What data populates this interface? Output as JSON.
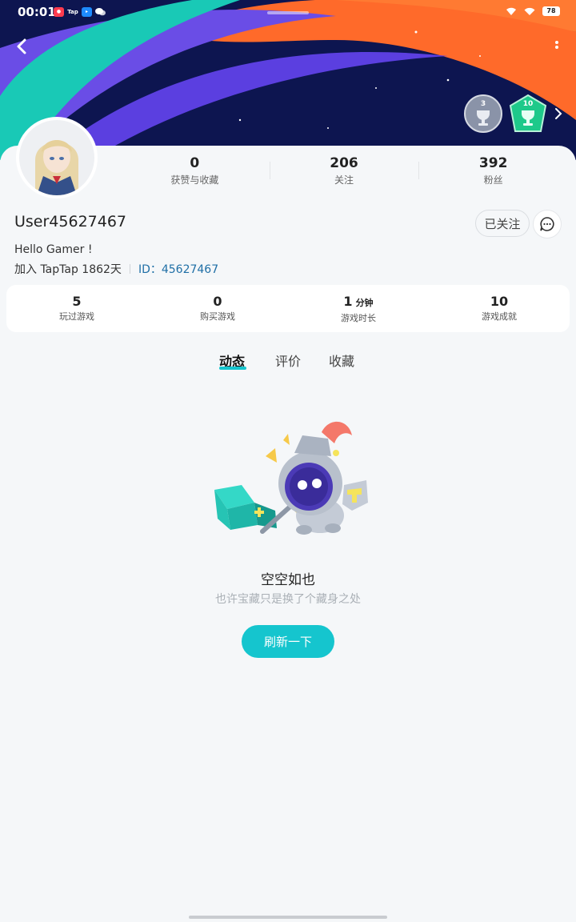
{
  "status_bar": {
    "time": "00:01",
    "notif_icons": [
      "app-red",
      "Tap",
      "app-blue",
      "wechat"
    ],
    "notif_tap_label": "Tap",
    "battery": "78"
  },
  "header": {
    "back_icon": "chevron-left-icon",
    "more_icon": "more-vertical-icon",
    "badges": [
      {
        "level": "3",
        "icon": "trophy-badge-icon",
        "color": "#8a93a8"
      },
      {
        "level": "10",
        "icon": "trophy-badge-icon",
        "color": "#1ec98a"
      }
    ]
  },
  "profile": {
    "stats": [
      {
        "value": "0",
        "label": "获赞与收藏"
      },
      {
        "value": "206",
        "label": "关注"
      },
      {
        "value": "392",
        "label": "粉丝"
      }
    ],
    "username": "User45627467",
    "follow_label": "已关注",
    "bio": "Hello Gamer !",
    "joined": "加入 TapTap 1862天",
    "id_text": "ID：45627467"
  },
  "game_stats": [
    {
      "value": "5",
      "unit": "",
      "label": "玩过游戏"
    },
    {
      "value": "0",
      "unit": "",
      "label": "购买游戏"
    },
    {
      "value": "1",
      "unit": "分钟",
      "label": "游戏时长"
    },
    {
      "value": "10",
      "unit": "",
      "label": "游戏成就"
    }
  ],
  "tabs": [
    {
      "label": "动态",
      "active": true
    },
    {
      "label": "评价",
      "active": false
    },
    {
      "label": "收藏",
      "active": false
    }
  ],
  "empty_state": {
    "title": "空空如也",
    "subtitle": "也许宝藏只是换了个藏身之处",
    "refresh_label": "刷新一下"
  },
  "colors": {
    "accent": "#15c5ce",
    "id_link": "#1f6fa6",
    "banner_bg": "#0d1550"
  }
}
